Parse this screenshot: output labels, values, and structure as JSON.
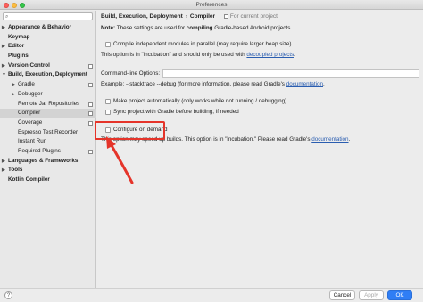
{
  "window": {
    "title": "Preferences"
  },
  "sidebar": {
    "search_placeholder": "",
    "items": [
      {
        "label": "Appearance & Behavior",
        "level": 0,
        "expandable": true,
        "expanded": false,
        "bold": true
      },
      {
        "label": "Keymap",
        "level": 0,
        "expandable": false,
        "bold": true
      },
      {
        "label": "Editor",
        "level": 0,
        "expandable": true,
        "expanded": false,
        "bold": true
      },
      {
        "label": "Plugins",
        "level": 0,
        "expandable": false,
        "bold": true
      },
      {
        "label": "Version Control",
        "level": 0,
        "expandable": true,
        "expanded": false,
        "bold": true,
        "project_icon": true
      },
      {
        "label": "Build, Execution, Deployment",
        "level": 0,
        "expandable": true,
        "expanded": true,
        "bold": true
      },
      {
        "label": "Gradle",
        "level": 1,
        "expandable": true,
        "expanded": false,
        "project_icon": true
      },
      {
        "label": "Debugger",
        "level": 1,
        "expandable": true,
        "expanded": false
      },
      {
        "label": "Remote Jar Repositories",
        "level": 1,
        "project_icon": true
      },
      {
        "label": "Compiler",
        "level": 1,
        "selected": true,
        "project_icon": true
      },
      {
        "label": "Coverage",
        "level": 1,
        "project_icon": true
      },
      {
        "label": "Espresso Test Recorder",
        "level": 1
      },
      {
        "label": "Instant Run",
        "level": 1
      },
      {
        "label": "Required Plugins",
        "level": 1,
        "project_icon": true
      },
      {
        "label": "Languages & Frameworks",
        "level": 0,
        "expandable": true,
        "expanded": false,
        "bold": true
      },
      {
        "label": "Tools",
        "level": 0,
        "expandable": true,
        "expanded": false,
        "bold": true
      },
      {
        "label": "Kotlin Compiler",
        "level": 0,
        "expandable": false,
        "bold": true
      }
    ]
  },
  "breadcrumb": {
    "part1": "Build, Execution, Deployment",
    "separator": "›",
    "part2": "Compiler",
    "scope": "For current project"
  },
  "main": {
    "note_label": "Note:",
    "note_text_prefix": "These settings are used for",
    "note_text_bold": "compiling",
    "note_text_suffix": "Gradle-based Android projects.",
    "parallel_label": "Compile independent modules in parallel (may require larger heap size)",
    "parallel_checked": false,
    "parallel_help_prefix": "This option is in \"incubation\" and should only be used with",
    "parallel_help_link": "decoupled projects",
    "parallel_help_suffix": ".",
    "cmdline_label": "Command-line Options:",
    "cmdline_value": "",
    "example_prefix": "Example: --stacktrace --debug (for more information, please read Gradle's",
    "example_link": "documentation",
    "example_suffix": ".",
    "auto_label": "Make project automatically (only works while not running / debugging)",
    "auto_checked": false,
    "sync_label": "Sync project with Gradle before building, if needed",
    "sync_checked": false,
    "configure_label": "Configure on demand",
    "configure_checked": false,
    "configure_help_prefix": "This option may speed up builds. This option is in \"incubation.\" Please read Gradle's",
    "configure_help_link": "documentation",
    "configure_help_suffix": "."
  },
  "footer": {
    "help_label": "?",
    "cancel_label": "Cancel",
    "apply_label": "Apply",
    "ok_label": "OK"
  },
  "colors": {
    "accent": "#2f7ef5",
    "annotation": "#e5342a",
    "link": "#2a5db0"
  }
}
